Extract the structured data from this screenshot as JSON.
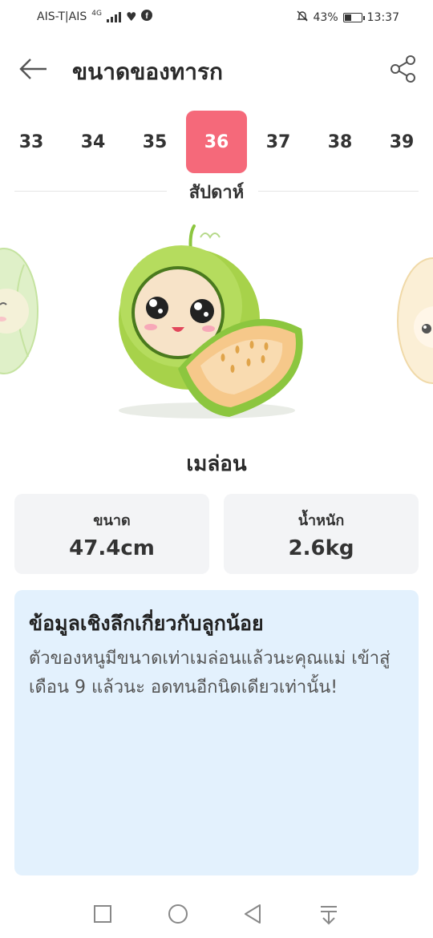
{
  "status_bar": {
    "carrier": "AIS-T|AIS",
    "network": "4G",
    "battery_percent": "43%",
    "battery_level": 0.43,
    "time": "13:37"
  },
  "header": {
    "title": "ขนาดของทารก"
  },
  "weeks": {
    "items": [
      "33",
      "34",
      "35",
      "36",
      "37",
      "38",
      "39"
    ],
    "selected": "36",
    "label": "สัปดาห์"
  },
  "fruit": {
    "name": "เมล่อน"
  },
  "stats": {
    "size_label": "ขนาด",
    "size_value": "47.4cm",
    "weight_label": "น้ำหนัก",
    "weight_value": "2.6kg"
  },
  "insight": {
    "title": "ข้อมูลเชิงลึกเกี่ยวกับลูกน้อย",
    "body": "ตัวของหนูมีขนาดเท่าเมล่อนแล้วนะคุณแม่ เข้าสู่เดือน 9 แล้วนะ อดทนอีกนิดเดียวเท่านั้น!"
  },
  "colors": {
    "accent": "#f5697a",
    "info_bg": "#e3f1fd",
    "card_bg": "#f3f4f6",
    "melon_green": "#8cc63f"
  }
}
